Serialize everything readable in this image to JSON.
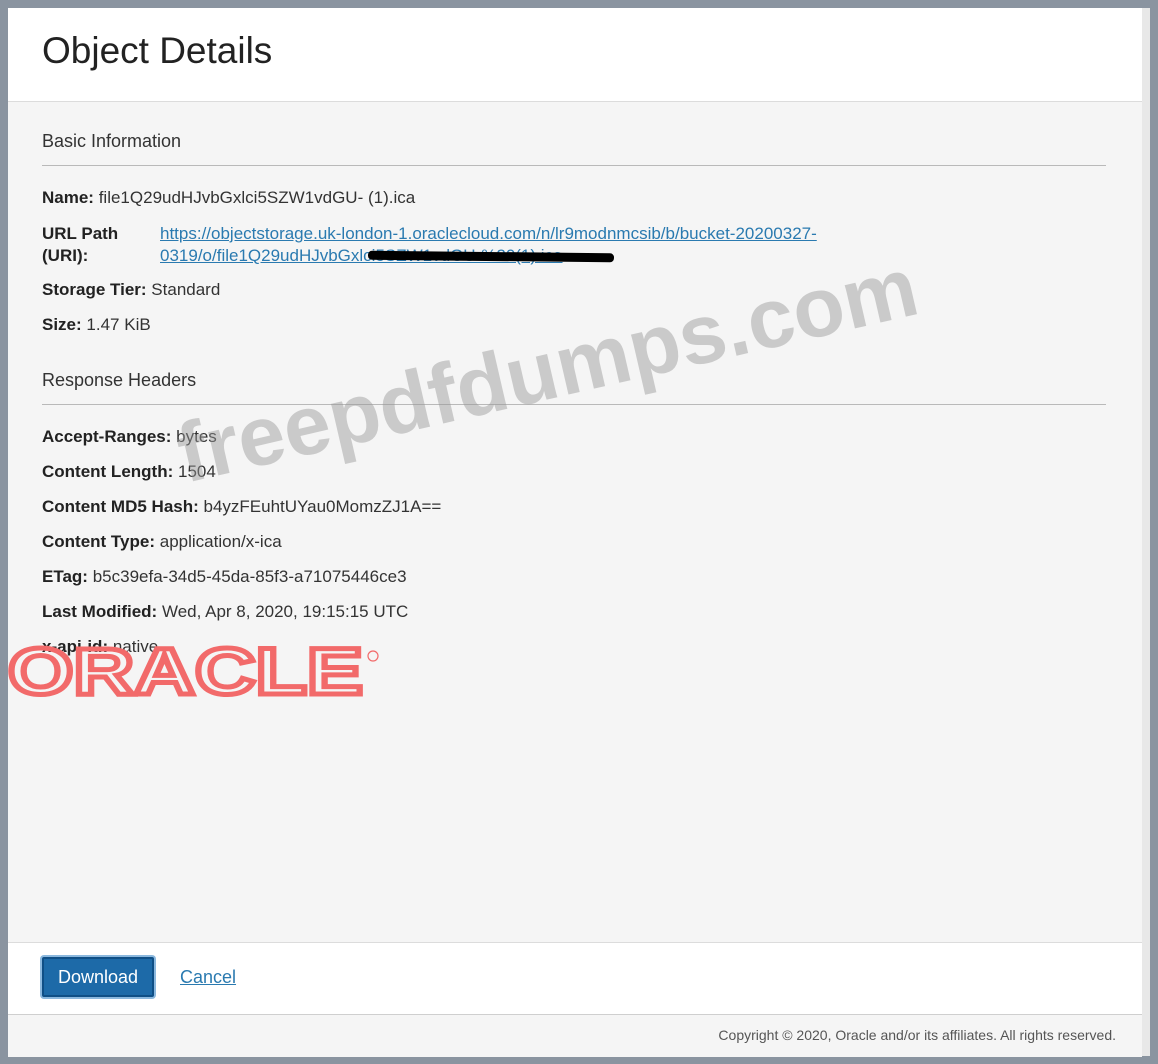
{
  "dialog": {
    "title": "Object Details"
  },
  "basic_info": {
    "section_title": "Basic Information",
    "name_label": "Name:",
    "name_value": "file1Q29udHJvbGxlci5SZW1vdGU- (1).ica",
    "url_label_line1": "URL Path",
    "url_label_line2": "(URI):",
    "url_line1": "https://objectstorage.uk-london-1.oraclecloud.com/n/lr9modnmcsib/b/bucket-20200327-",
    "url_line2": "0319/o/file1Q29udHJvbGxlci5SZW1vdGU-%20(1).ica",
    "storage_tier_label": "Storage Tier:",
    "storage_tier_value": "Standard",
    "size_label": "Size:",
    "size_value": "1.47 KiB"
  },
  "response_headers": {
    "section_title": "Response Headers",
    "accept_ranges_label": "Accept-Ranges:",
    "accept_ranges_value": "bytes",
    "content_length_label": "Content Length:",
    "content_length_value": "1504",
    "content_md5_label": "Content MD5 Hash:",
    "content_md5_value": "b4yzFEuhtUYau0MomzZJ1A==",
    "content_type_label": "Content Type:",
    "content_type_value": "application/x-ica",
    "etag_label": "ETag:",
    "etag_value": "b5c39efa-34d5-45da-85f3-a71075446ce3",
    "last_modified_label": "Last Modified:",
    "last_modified_value": "Wed, Apr 8, 2020, 19:15:15 UTC",
    "api_id_label": "x-api-id:",
    "api_id_value": "native"
  },
  "actions": {
    "download_label": "Download",
    "cancel_label": "Cancel"
  },
  "footer": {
    "copyright": "Copyright © 2020, Oracle and/or its affiliates. All rights reserved."
  },
  "overlays": {
    "watermark_text": "freepdfdumps.com",
    "logo_text": "ORACLE",
    "logo_color": "#f26a6a"
  },
  "colors": {
    "link": "#2a7ab0",
    "primary_button": "#1d6aa8"
  }
}
